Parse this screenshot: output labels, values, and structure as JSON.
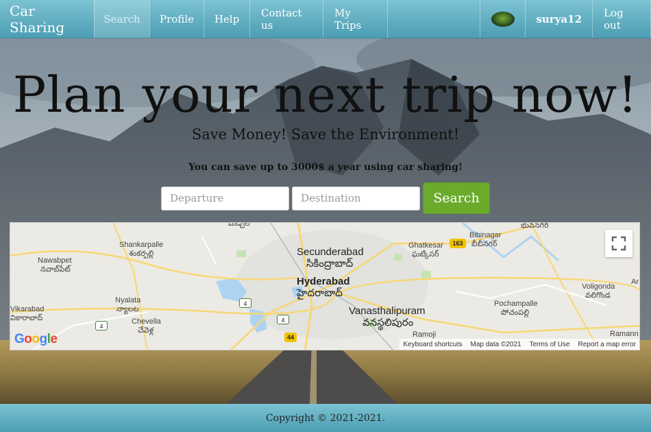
{
  "navbar": {
    "brand": "Car Sharing",
    "items": [
      {
        "label": "Search",
        "active": true
      },
      {
        "label": "Profile"
      },
      {
        "label": "Help"
      },
      {
        "label": "Contact us"
      },
      {
        "label": "My Trips"
      }
    ],
    "username": "surya12",
    "logout": "Log out"
  },
  "hero": {
    "title": "Plan your next trip now!",
    "subtitle": "Save Money! Save the Environment!",
    "tagline": "You can save up to 3000$ a year using car sharing!"
  },
  "search": {
    "departure_placeholder": "Departure",
    "destination_placeholder": "Destination",
    "button_label": "Search"
  },
  "map": {
    "labels": {
      "secunderabad": "Secunderabad",
      "secunderabad_te": "సికింద్రాబాద్",
      "hyderabad": "Hyderabad",
      "hyderabad_te": "హైదరాబాద్",
      "vanasthalipuram": "Vanasthalipuram",
      "vanasthalipuram_te": "వనస్థలిపురం",
      "shankarpalle": "Shankarpalle",
      "shankarpalle_te": "శంకర్పల్లి",
      "nawabpet": "Nawabpet",
      "nawabpet_te": "నవాబ్‌పేట్",
      "nyalata": "Nyalata",
      "nyalata_te": "న్యాలట",
      "chevella": "Chevella",
      "chevella_te": "చేవెళ్ల",
      "vikarabad": "Vikarabad",
      "vikarabad_te": "వికారాబాద్",
      "bibinagar": "Bibinagar",
      "bibinagar_te": "బీబీనగర్",
      "ghatkesar": "Ghatkesar",
      "ghatkesar_te": "ఘట్కేసర్",
      "pochampalle": "Pochampalle",
      "pochampalle_te": "పోచంపల్లి",
      "voligonda": "Voligonda",
      "voligonda_te": "వలిగొండ",
      "ramannapet": "Ramann",
      "ramoji": "Ramoji",
      "bhuvanagiri_te": "భువనగిరి",
      "top_te": "మేడ్చల్",
      "ar": "Ar"
    },
    "shields": {
      "nh163": "163",
      "nh44": "44",
      "r4a": "4",
      "r4b": "4",
      "r4c": "4"
    },
    "google": "Google",
    "attribution": {
      "shortcuts": "Keyboard shortcuts",
      "data": "Map data ©2021",
      "terms": "Terms of Use",
      "report": "Report a map error"
    }
  },
  "footer": {
    "copyright": "Copyright © 2021-2021."
  },
  "colors": {
    "accent": "#6aab2c",
    "navbar": "#5fb0c4"
  }
}
